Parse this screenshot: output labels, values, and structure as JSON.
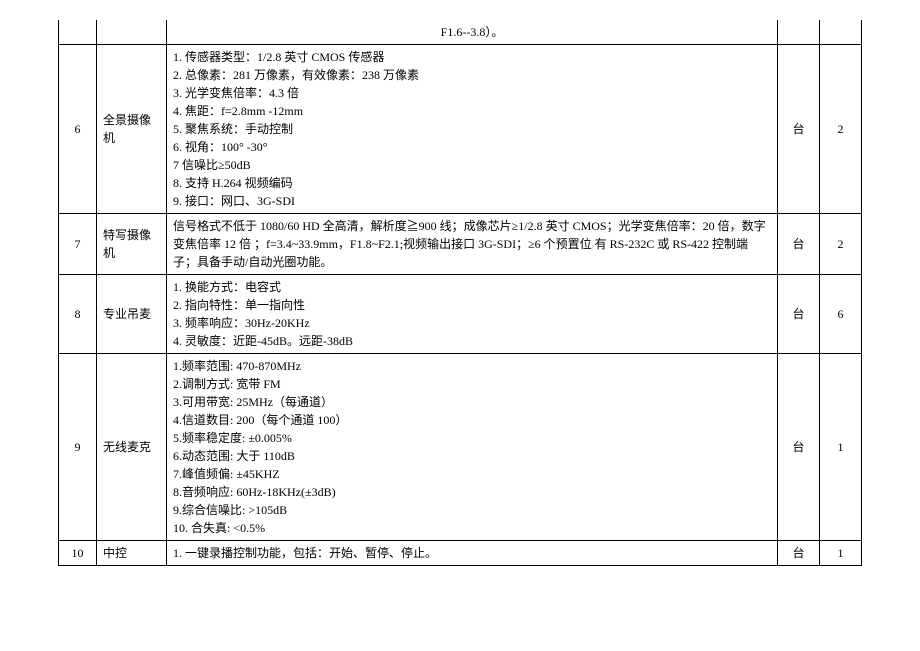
{
  "rows": [
    {
      "num": "",
      "name": "",
      "spec": [
        "F1.6--3.8）。"
      ],
      "unit": "",
      "qty": ""
    },
    {
      "num": "6",
      "name": "全景摄像机",
      "spec": [
        "1. 传感器类型：1/2.8 英寸 CMOS 传感器",
        "2. 总像素：281 万像素，有效像素：238 万像素",
        "3. 光学变焦倍率：4.3 倍",
        "4. 焦距：f=2.8mm -12mm",
        "5. 聚焦系统：手动控制",
        "6. 视角：100° -30°",
        "7  信噪比≥50dB",
        "8. 支持 H.264 视频编码",
        "9. 接口：网口、3G-SDI"
      ],
      "unit": "台",
      "qty": "2"
    },
    {
      "num": "7",
      "name": "特写摄像机",
      "spec": [
        "信号格式不低于 1080/60 HD 全高清，解析度≧900 线；成像芯片≥1/2.8 英寸 CMOS；光学变焦倍率：20 倍，数字变焦倍率 12 倍 ；f=3.4~33.9mm，F1.8~F2.1;视频输出接口 3G-SDI；≥6 个预置位 有 RS-232C 或 RS-422 控制端子；具备手动/自动光圈功能。"
      ],
      "unit": "台",
      "qty": "2"
    },
    {
      "num": "8",
      "name": "专业吊麦",
      "spec": [
        "1. 换能方式：电容式",
        "2. 指向特性：单一指向性",
        "3. 频率响应：30Hz-20KHz",
        "4. 灵敏度：近距-45dB。远距-38dB"
      ],
      "unit": "台",
      "qty": "6"
    },
    {
      "num": "9",
      "name": "无线麦克",
      "spec": [
        "1.频率范围: 470-870MHz",
        "2.调制方式: 宽带 FM",
        "3.可用带宽: 25MHz（每通道）",
        "4.信道数目: 200（每个通道 100）",
        "5.频率稳定度: ±0.005%",
        "6.动态范围: 大于 110dB",
        "7.峰值频偏: ±45KHZ",
        "8.音频响应: 60Hz-18KHz(±3dB)",
        "9.综合信噪比: >105dB",
        "10.  合失真: <0.5%"
      ],
      "unit": "台",
      "qty": "1"
    },
    {
      "num": "10",
      "name": "中控",
      "spec": [
        "1.    一键录播控制功能，包括：开始、暂停、停止。"
      ],
      "unit": "台",
      "qty": "1"
    }
  ]
}
